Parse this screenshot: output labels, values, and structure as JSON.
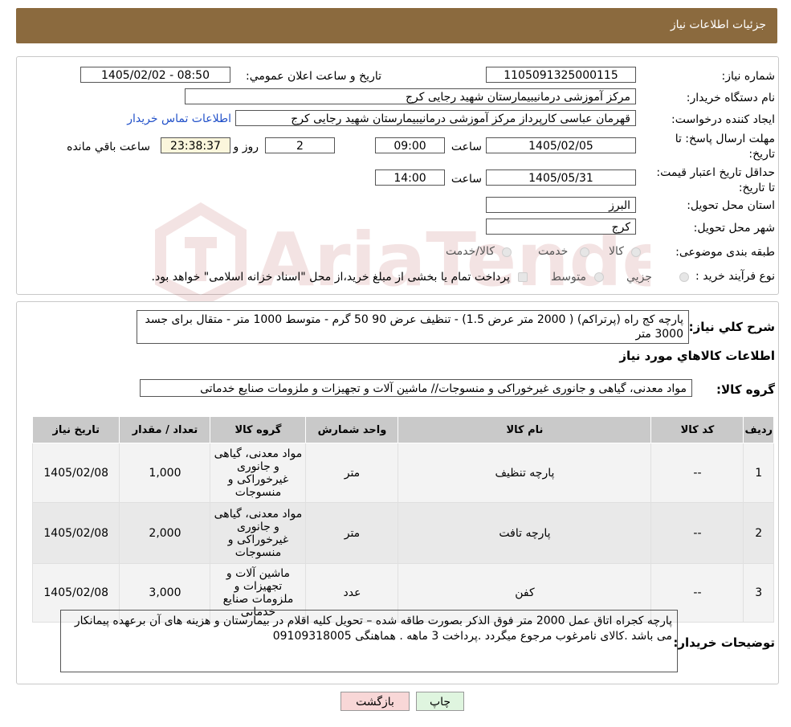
{
  "header": {
    "title": "جزئیات اطلاعات نیاز"
  },
  "fields": {
    "need_number_label": "شماره نیاز:",
    "need_number": "1105091325000115",
    "announce_label": "تاریخ و ساعت اعلان عمومي:",
    "announce_value": "1405/02/02 - 08:50",
    "buyer_label": "نام دستگاه خریدار:",
    "buyer_value": "مرکز آموزشی درمانیبیمارستان شهید رجایی کرج",
    "creator_label": "ایجاد کننده درخواست:",
    "creator_value": "قهرمان عباسی کارپرداز مرکز آموزشی درمانیبیمارستان شهید رجایی کرج",
    "contact_link": "اطلاعات تماس خریدار",
    "deadline_label": "مهلت ارسال پاسخ: تا تاریخ:",
    "deadline_date": "1405/02/05",
    "time_label": "ساعت",
    "deadline_time": "09:00",
    "days_value": "2",
    "days_label": "روز و",
    "remaining_time": "23:38:37",
    "remaining_label": "ساعت باقي مانده",
    "validity_label": "حداقل تاریخ اعتبار قیمت: تا تاریخ:",
    "validity_date": "1405/05/31",
    "validity_time": "14:00",
    "province_label": "استان محل تحویل:",
    "province_value": "البرز",
    "city_label": "شهر محل تحویل:",
    "city_value": "کرج",
    "category_label": "طبقه بندی موضوعی:",
    "category_options": [
      "کالا",
      "خدمت",
      "کالا/خدمت"
    ],
    "process_label": "نوع فرآیند خرید :",
    "process_options": [
      "جزیي",
      "متوسط"
    ],
    "process_note": "پرداخت تمام یا بخشی از مبلغ خرید،از محل \"اسناد خزانه اسلامی\" خواهد بود."
  },
  "summary": {
    "label": "شرح کلي نیاز:",
    "text": "پارچه کج راه (پرتراکم)  ( 2000 متر عرض 1.5) -  تنظیف عرض 90  50 گرم - متوسط   1000  متر -  متقال  برای جسد 3000 متر"
  },
  "goods_info_title": "اطلاعات کالاهاي مورد نیاز",
  "goods_group": {
    "label": "گروه کالا:",
    "value": "مواد معدنی، گیاهی و جانوری غیرخوراکی و منسوجات// ماشین آلات و تجهیزات و ملزومات صنایع خدماتی"
  },
  "table": {
    "headers": [
      "ردیف",
      "کد کالا",
      "نام کالا",
      "واحد شمارش",
      "گروه کالا",
      "تعداد / مقدار",
      "تاریخ نیاز"
    ],
    "rows": [
      {
        "row": "1",
        "code": "--",
        "name": "پارچه تنظیف",
        "unit": "متر",
        "group": "مواد معدنی، گیاهی و جانوری غیرخوراکی و منسوجات",
        "qty": "1,000",
        "date": "1405/02/08"
      },
      {
        "row": "2",
        "code": "--",
        "name": "پارچه تافت",
        "unit": "متر",
        "group": "مواد معدنی، گیاهی و جانوری غیرخوراکی و منسوجات",
        "qty": "2,000",
        "date": "1405/02/08"
      },
      {
        "row": "3",
        "code": "--",
        "name": "کفن",
        "unit": "عدد",
        "group": "ماشین آلات و تجهیزات و ملزومات صنایع خدماتی",
        "qty": "3,000",
        "date": "1405/02/08"
      }
    ]
  },
  "buyer_notes": {
    "label": "توضیحات خریدار:",
    "text": "پارچه کجراه اتاق عمل 2000 متر فوق الذکر بصورت طاقه  شده – تحویل کلیه اقلام در بیمارستان و هزینه های آن برعهده پیمانکار می باشد .کالای نامرغوب مرجوع میگردد .پرداخت 3 ماهه . هماهنگی 09109318005"
  },
  "buttons": {
    "print": "چاپ",
    "back": "بازگشت"
  },
  "watermark": {
    "text": "AriaTender.neT"
  },
  "colors": {
    "header": "#8b6a3e",
    "link": "#2251c9",
    "back_button": "#f8d7d7",
    "print_button": "#dff5df"
  }
}
